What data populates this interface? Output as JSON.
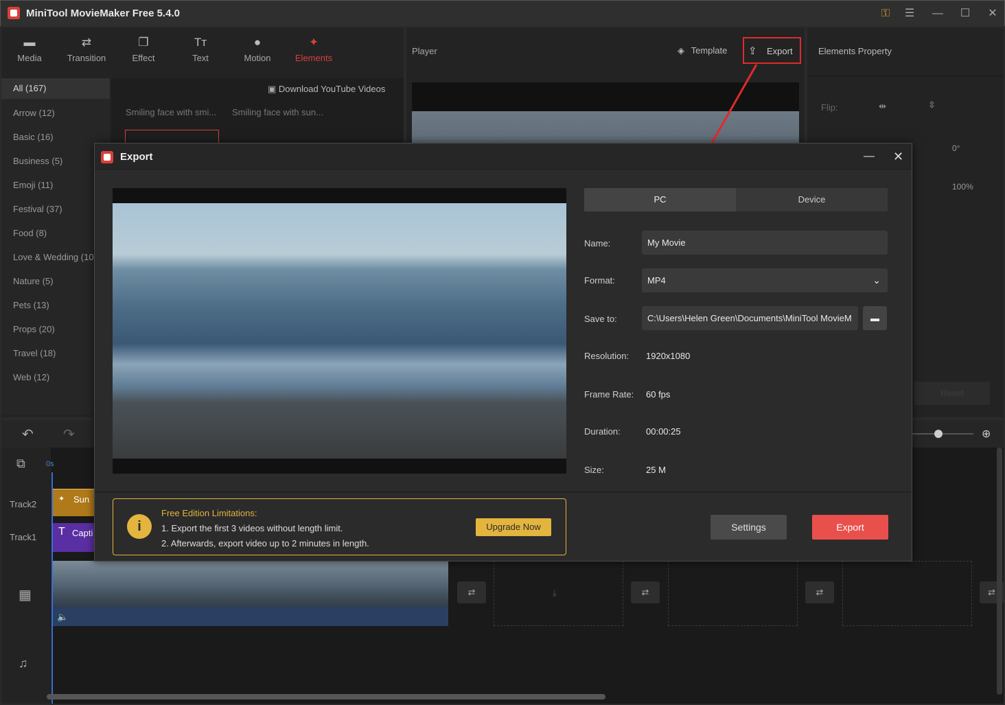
{
  "app": {
    "title": "MiniTool MovieMaker Free 5.4.0"
  },
  "toolbar": {
    "tabs": [
      {
        "label": "Media",
        "icon": "folder-icon"
      },
      {
        "label": "Transition",
        "icon": "swap-icon"
      },
      {
        "label": "Effect",
        "icon": "effect-icon"
      },
      {
        "label": "Text",
        "icon": "text-icon"
      },
      {
        "label": "Motion",
        "icon": "motion-icon"
      },
      {
        "label": "Elements",
        "icon": "elements-icon"
      }
    ],
    "active": "Elements"
  },
  "elements": {
    "download_label": "Download YouTube Videos",
    "items": [
      "Smiling face with smi...",
      "Smiling face with sun..."
    ]
  },
  "categories": [
    "All (167)",
    "Arrow (12)",
    "Basic (16)",
    "Business (5)",
    "Emoji (11)",
    "Festival (37)",
    "Food (8)",
    "Love & Wedding (10)",
    "Nature (5)",
    "Pets (13)",
    "Props (20)",
    "Travel (18)",
    "Web (12)"
  ],
  "player": {
    "label": "Player",
    "template_label": "Template",
    "export_label": "Export"
  },
  "props": {
    "title": "Elements Property",
    "flip_label": "Flip:",
    "rotation": "0°",
    "scale": "100%",
    "reset": "Reset"
  },
  "timeline": {
    "ruler_start": "0s",
    "tracks": [
      "Track2",
      "Track1"
    ],
    "clip_sun": "Sun",
    "clip_caption": "Capti"
  },
  "dialog": {
    "title": "Export",
    "tabs": [
      "PC",
      "Device"
    ],
    "active_tab": "PC",
    "fields": {
      "name_label": "Name:",
      "name_value": "My Movie",
      "format_label": "Format:",
      "format_value": "MP4",
      "save_label": "Save to:",
      "save_value": "C:\\Users\\Helen Green\\Documents\\MiniTool MovieM",
      "resolution_label": "Resolution:",
      "resolution_value": "1920x1080",
      "framerate_label": "Frame Rate:",
      "framerate_value": "60 fps",
      "duration_label": "Duration:",
      "duration_value": "00:00:25",
      "size_label": "Size:",
      "size_value": "25 M"
    },
    "limitations": {
      "title": "Free Edition Limitations:",
      "line1": "1. Export the first 3 videos without length limit.",
      "line2": "2. Afterwards, export video up to 2 minutes in length.",
      "upgrade_label": "Upgrade Now"
    },
    "settings_label": "Settings",
    "export_label": "Export"
  },
  "colors": {
    "accent": "#e94f4b",
    "highlight_box": "#e02b2b",
    "limit_border": "#e3b53f",
    "upgrade_bg": "#e3b53f"
  }
}
